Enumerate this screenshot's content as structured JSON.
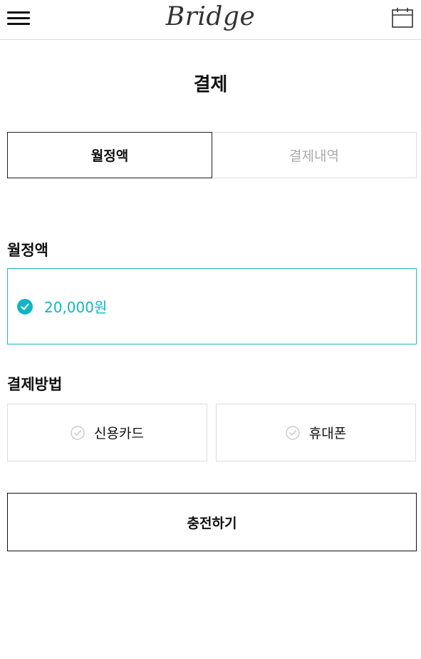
{
  "header": {
    "logo_text": "Bridge",
    "menu_icon": "hamburger-menu-icon",
    "calendar_icon": "calendar-icon"
  },
  "page": {
    "title": "결제"
  },
  "tabs": [
    {
      "label": "월정액",
      "active": true
    },
    {
      "label": "결제내역",
      "active": false
    }
  ],
  "monthly": {
    "section_label": "월정액",
    "amount": "20,000원",
    "selected": true,
    "accent_color": "#11b5c2"
  },
  "payment_method": {
    "section_label": "결제방법",
    "options": [
      {
        "label": "신용카드",
        "selected": false
      },
      {
        "label": "휴대폰",
        "selected": false
      }
    ]
  },
  "actions": {
    "charge_label": "충전하기"
  }
}
